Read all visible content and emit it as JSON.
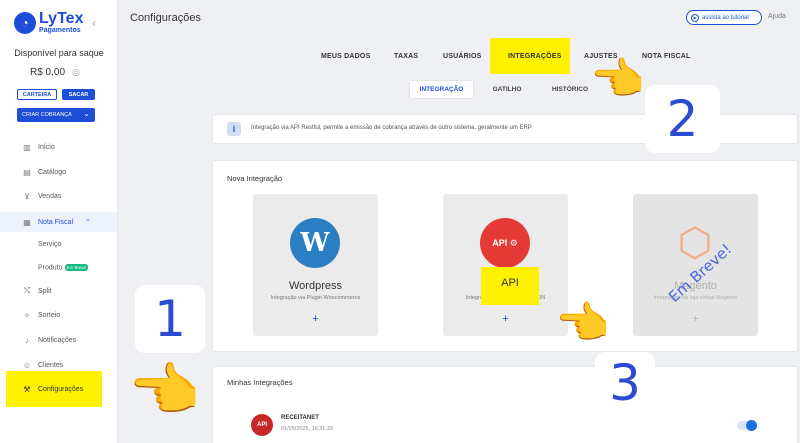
{
  "sidebar": {
    "logo_name": "LyTex",
    "logo_sub": "Pagamentos",
    "balance_label": "Disponível para saque",
    "balance_value": "R$ 0,00",
    "wallet_button": "CARTEIRA",
    "withdraw_button": "SACAR",
    "charge_button": "CRIAR COBRANÇA",
    "items": [
      {
        "label": "Início",
        "icon": "chart-icon"
      },
      {
        "label": "Catálogo",
        "icon": "catalog-icon"
      },
      {
        "label": "Vendas",
        "icon": "cart-icon"
      },
      {
        "label": "Nota Fiscal",
        "icon": "invoice-icon"
      },
      {
        "label": "Serviço",
        "icon": ""
      },
      {
        "label": "Produto",
        "icon": "",
        "badge": "Em Breve"
      },
      {
        "label": "Split",
        "icon": "split-icon"
      },
      {
        "label": "Sorteio",
        "icon": "gift-icon"
      },
      {
        "label": "Notificações",
        "icon": "bell-icon"
      },
      {
        "label": "Clientes",
        "icon": "users-icon"
      },
      {
        "label": "Configurações",
        "icon": "wrench-icon"
      }
    ]
  },
  "header": {
    "title": "Configurações",
    "assist_button": "assista ao tutorial",
    "help": "Ajuda"
  },
  "tabs": [
    "MEUS DADOS",
    "TAXAS",
    "USUÁRIOS",
    "INTEGRAÇÕES",
    "AJUSTES",
    "NOTA FISCAL"
  ],
  "subtabs": [
    "INTEGRAÇÃO",
    "GATILHO",
    "HISTÓRICO"
  ],
  "info_text": "Integração via API Restful, permite a emissão de cobrança através de outro sistema, geralmente um ERP",
  "new_integration": {
    "title": "Nova Integração",
    "cards": [
      {
        "name": "Wordpress",
        "desc": "Integração via Plugin Woocommerce",
        "plus": "+"
      },
      {
        "name": "API",
        "desc": "Integração via API Restful JSON",
        "plus": "+"
      },
      {
        "name": "Magento",
        "desc": "Integração via loja virtual Magento",
        "plus": "+",
        "stamp": "Em Breve!"
      }
    ]
  },
  "my_integrations": {
    "title": "Minhas Integrações",
    "items": [
      {
        "name": "RECEITANET",
        "date": "01/05/2025, 16:21:33",
        "enabled": true
      }
    ]
  },
  "annotations": [
    "1",
    "2",
    "3"
  ],
  "colors": {
    "accent": "#1d4ed8",
    "highlight": "#fff200"
  }
}
